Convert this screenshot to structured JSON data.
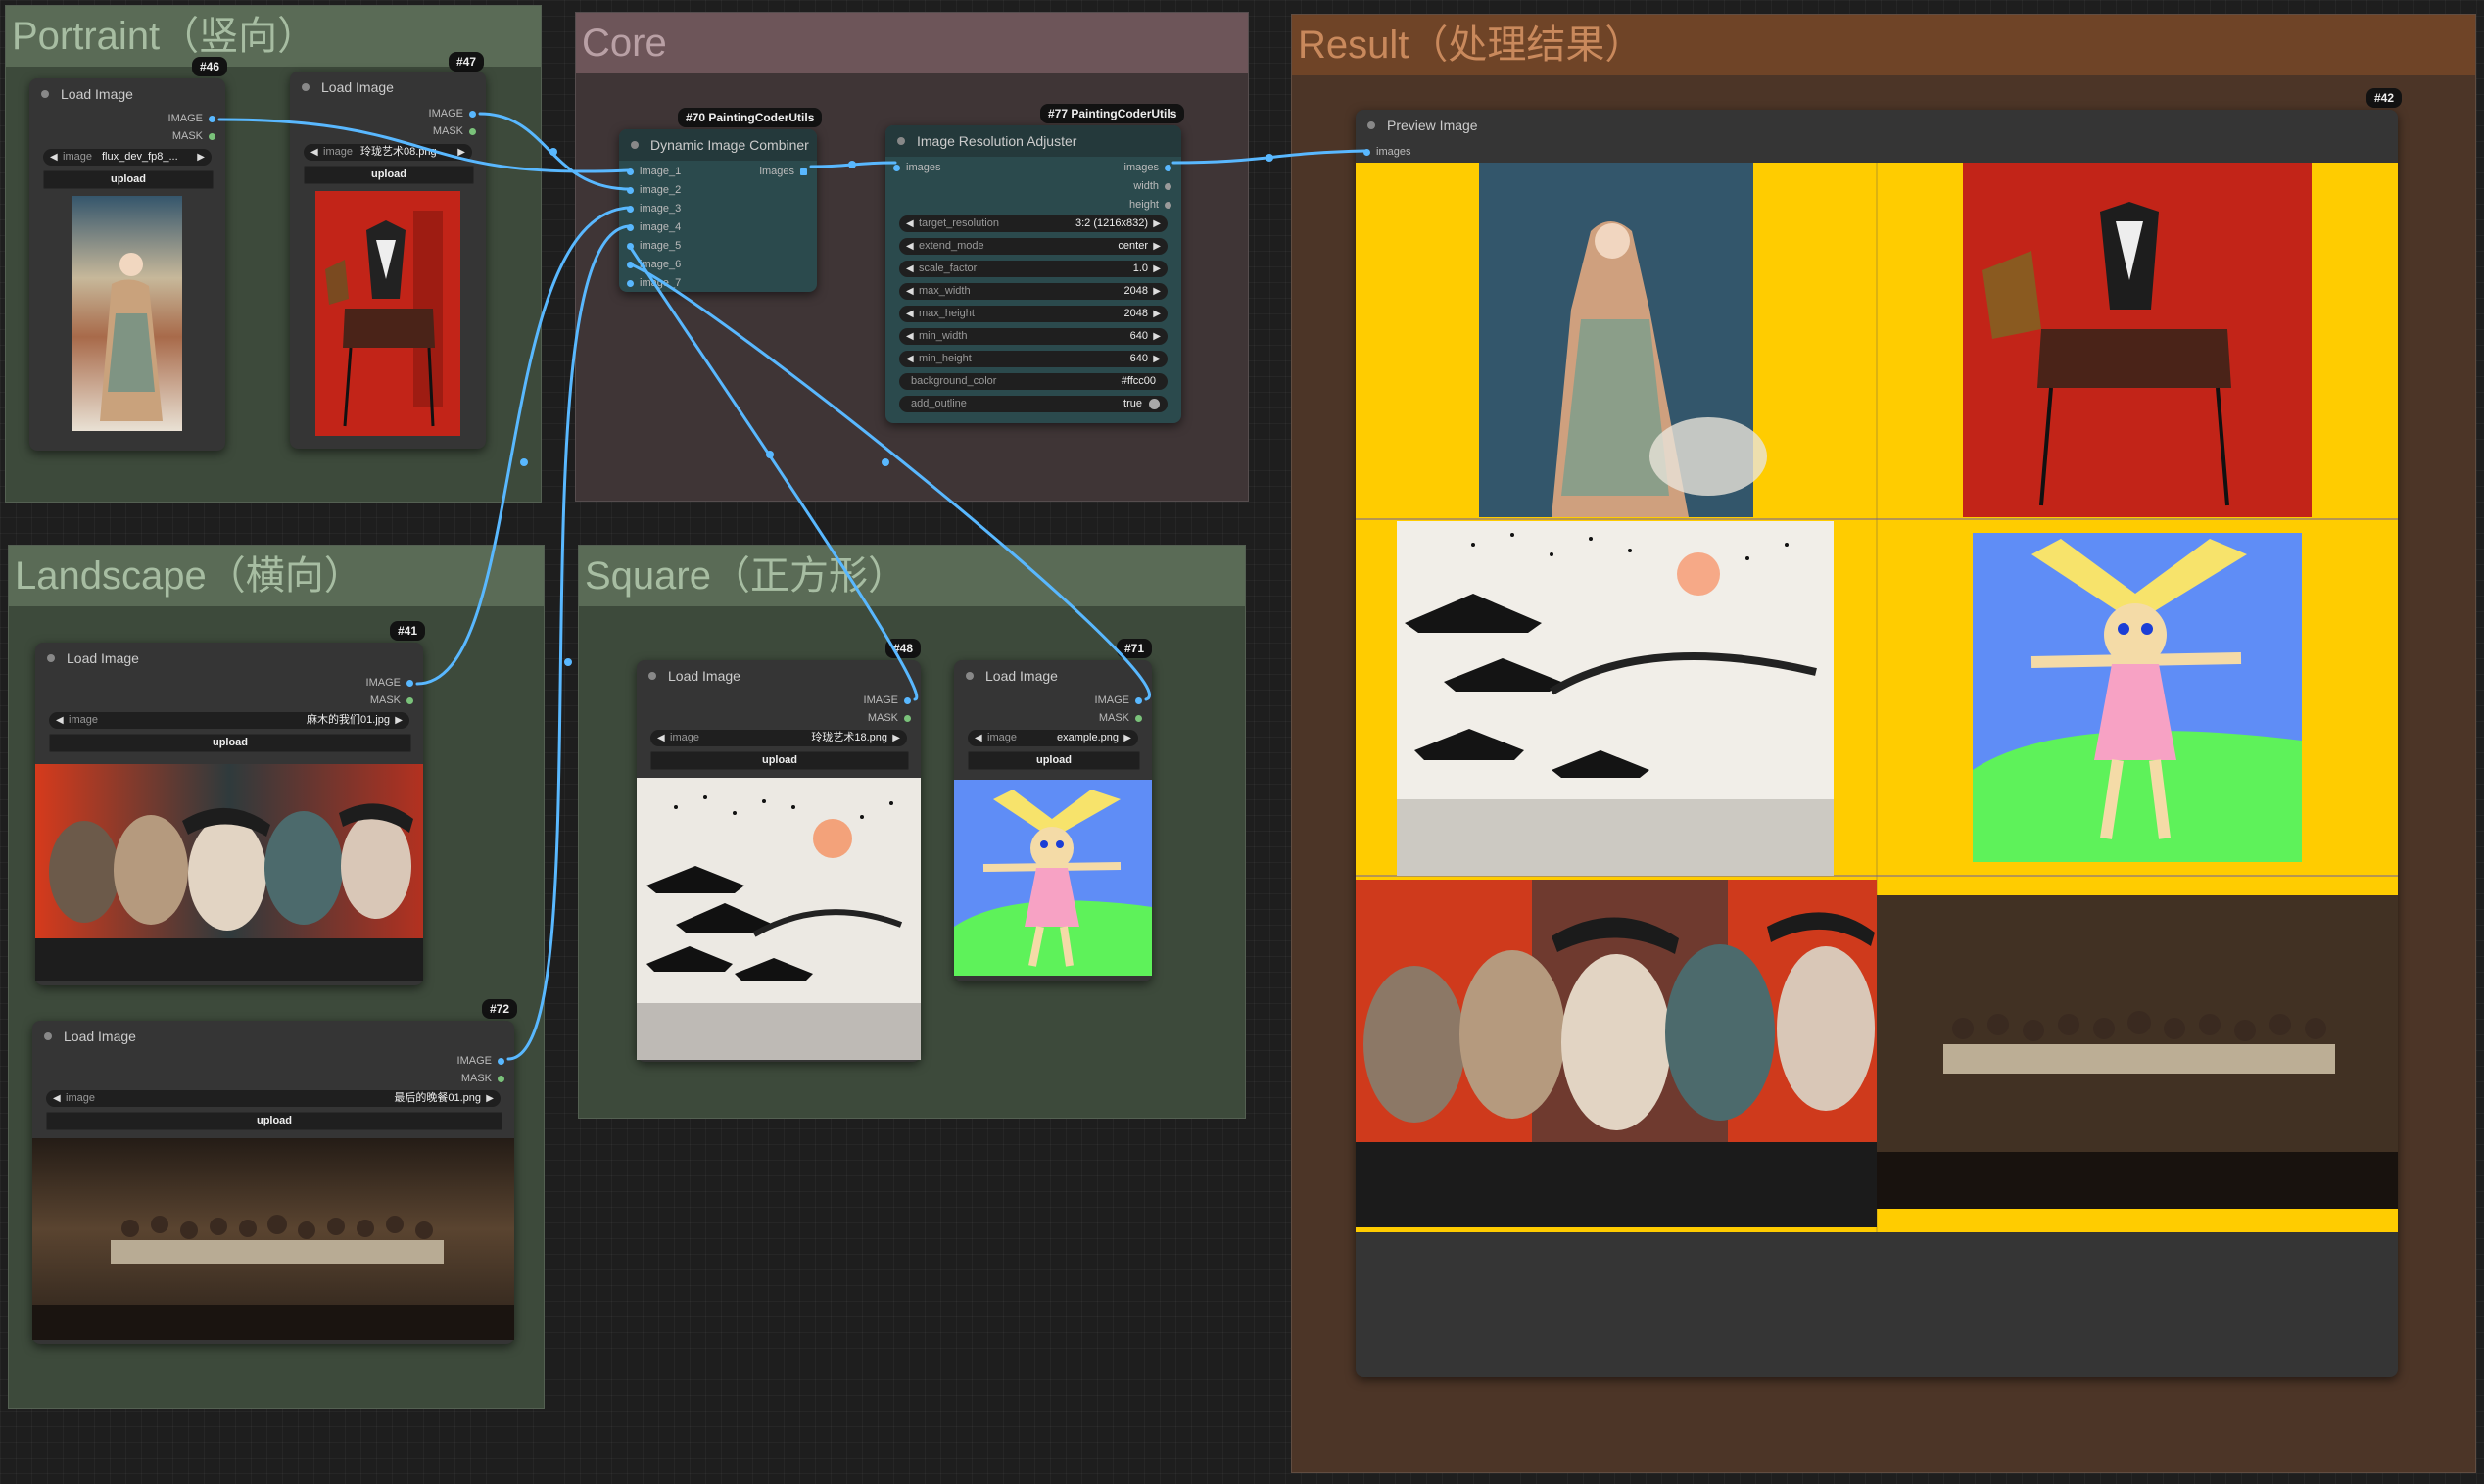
{
  "groups": {
    "portrait": "Portraint（竖向）",
    "landscape": "Landscape（横向）",
    "core": "Core",
    "square": "Square（正方形）",
    "result": "Result（处理结果）"
  },
  "nodes": {
    "n46": {
      "badge": "#46",
      "title": "Load Image",
      "out1": "IMAGE",
      "out2": "MASK",
      "widget_label": "image",
      "widget_value": "flux_dev_fp8_...",
      "upload": "upload"
    },
    "n47": {
      "badge": "#47",
      "title": "Load Image",
      "out1": "IMAGE",
      "out2": "MASK",
      "widget_label": "image",
      "widget_value": "玲珑艺术08.png",
      "upload": "upload"
    },
    "n41": {
      "badge": "#41",
      "title": "Load Image",
      "out1": "IMAGE",
      "out2": "MASK",
      "widget_label": "image",
      "widget_value": "麻木的我们01.jpg",
      "upload": "upload"
    },
    "n72": {
      "badge": "#72",
      "title": "Load Image",
      "out1": "IMAGE",
      "out2": "MASK",
      "widget_label": "image",
      "widget_value": "最后的晚餐01.png",
      "upload": "upload"
    },
    "n48": {
      "badge": "#48",
      "title": "Load Image",
      "out1": "IMAGE",
      "out2": "MASK",
      "widget_label": "image",
      "widget_value": "玲珑艺术18.png",
      "upload": "upload"
    },
    "n71": {
      "badge": "#71",
      "title": "Load Image",
      "out1": "IMAGE",
      "out2": "MASK",
      "widget_label": "image",
      "widget_value": "example.png",
      "upload": "upload"
    },
    "n70": {
      "badge": "#70 PaintingCoderUtils",
      "title": "Dynamic Image Combiner",
      "inputs": [
        "image_1",
        "image_2",
        "image_3",
        "image_4",
        "image_5",
        "image_6",
        "image_7"
      ],
      "output": "images"
    },
    "n77": {
      "badge": "#77 PaintingCoderUtils",
      "title": "Image Resolution Adjuster",
      "input": "images",
      "outputs": [
        "images",
        "width",
        "height"
      ],
      "widgets": [
        {
          "label": "target_resolution",
          "value": "3:2 (1216x832)"
        },
        {
          "label": "extend_mode",
          "value": "center"
        },
        {
          "label": "scale_factor",
          "value": "1.0"
        },
        {
          "label": "max_width",
          "value": "2048"
        },
        {
          "label": "max_height",
          "value": "2048"
        },
        {
          "label": "min_width",
          "value": "640"
        },
        {
          "label": "min_height",
          "value": "640"
        },
        {
          "label": "background_color",
          "value": "#ffcc00"
        },
        {
          "label": "add_outline",
          "value": "true"
        }
      ]
    },
    "n42": {
      "badge": "#42",
      "title": "Preview Image",
      "input": "images"
    }
  },
  "colors": {
    "background_fill": "#ffcc00",
    "link": "#59b8ff"
  }
}
